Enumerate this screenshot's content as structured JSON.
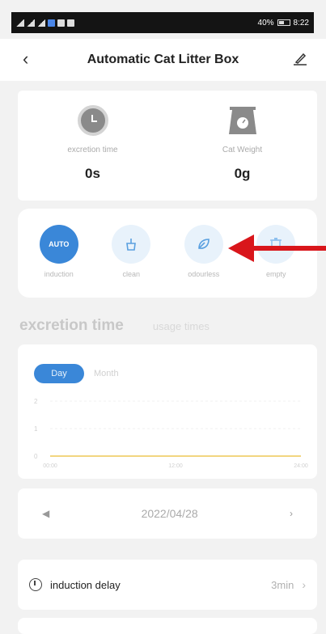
{
  "status_bar": {
    "battery": "40%",
    "time": "8:22"
  },
  "header": {
    "title": "Automatic Cat Litter Box"
  },
  "stats": [
    {
      "label": "excretion time",
      "value": "0s",
      "icon": "clock-icon"
    },
    {
      "label": "Cat Weight",
      "value": "0g",
      "icon": "scale-icon"
    }
  ],
  "modes": [
    {
      "label": "induction",
      "icon_text": "AUTO",
      "active": true
    },
    {
      "label": "clean",
      "icon": "broom-icon",
      "active": false
    },
    {
      "label": "odourless",
      "icon": "leaf-icon",
      "active": false
    },
    {
      "label": "empty",
      "icon": "trash-icon",
      "active": false
    }
  ],
  "tabs": {
    "active": "excretion time",
    "inactive": "usage times"
  },
  "chart": {
    "segment": {
      "day": "Day",
      "month": "Month"
    },
    "y_ticks": [
      "2",
      "1",
      "0"
    ],
    "x_ticks": [
      "00:00",
      "12:00",
      "24:00"
    ]
  },
  "chart_data": {
    "type": "line",
    "x": [
      "00:00",
      "12:00",
      "24:00"
    ],
    "series": [
      {
        "values": [
          0,
          0,
          0
        ]
      }
    ],
    "ylim": [
      0,
      2
    ]
  },
  "date_nav": {
    "date": "2022/04/28",
    "prev": "◀",
    "next": "›"
  },
  "delay": {
    "label": "induction delay",
    "value": "3min",
    "chevron": "›"
  },
  "colors": {
    "accent": "#3a87d8",
    "arrow": "#d9161b",
    "line": "#f2d680"
  }
}
